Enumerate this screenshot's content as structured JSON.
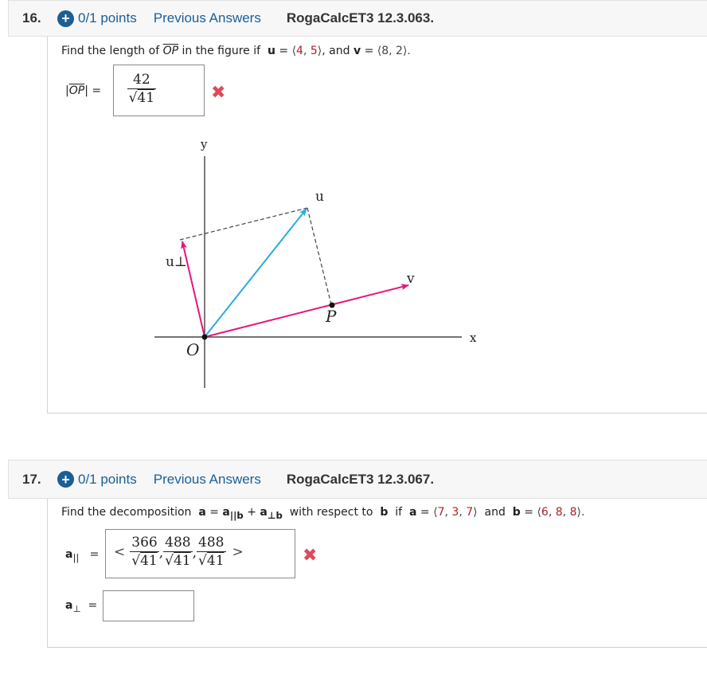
{
  "questions": [
    {
      "number": "16.",
      "points": "0/1 points",
      "previous_answers": "Previous Answers",
      "source": "RogaCalcET3 12.3.063.",
      "prompt": {
        "part1": "Find the length of",
        "op": "OP",
        "part2": "in the figure if",
        "u": "u",
        "eq": "=",
        "u_open": "⟨",
        "u_x": "4",
        "comma": ",",
        "u_y": "5",
        "u_close": "⟩",
        "and": ", and",
        "v": "v",
        "v_open": "⟨",
        "v_x": "8",
        "v_y": "2",
        "v_close": "⟩."
      },
      "answer_label": "|OP| =",
      "answer_label_op": "OP",
      "answer": {
        "numerator": "42",
        "denominator": "41",
        "radical": "√"
      },
      "status": "incorrect",
      "figure": {
        "axis_x_label": "x",
        "axis_y_label": "y",
        "origin_label": "O",
        "point_label": "P",
        "u_label": "u",
        "v_label": "v",
        "u_perp_label": "u⊥",
        "colors": {
          "u": "#29abe2",
          "v": "#e6157f",
          "u_perp": "#e6157f",
          "dashed": "#444444"
        }
      }
    },
    {
      "number": "17.",
      "points": "0/1 points",
      "previous_answers": "Previous Answers",
      "source": "RogaCalcET3 12.3.067.",
      "prompt": {
        "part1": "Find the decomposition",
        "a": "a",
        "eq": "=",
        "a_par": "a",
        "sub_par": "||b",
        "plus": "+",
        "a_perp": "a",
        "sub_perp": "⊥b",
        "part2": "with respect to",
        "b": "b",
        "if": "if",
        "a2": "a",
        "a_vals": [
          "7",
          "3",
          "7"
        ],
        "and": "and",
        "b2": "b",
        "b_vals": [
          "6",
          "8",
          "8"
        ]
      },
      "a_parallel": {
        "label": "a",
        "sub": "||",
        "eq": "=",
        "open": "<",
        "close": ">",
        "radical": "√",
        "components": [
          {
            "numerator": "366",
            "denominator": "41"
          },
          {
            "numerator": "488",
            "denominator": "41"
          },
          {
            "numerator": "488",
            "denominator": "41"
          }
        ],
        "status": "incorrect"
      },
      "a_perp": {
        "label": "a",
        "sub": "⊥",
        "eq": "=",
        "value": ""
      }
    }
  ],
  "icons": {
    "plus": "+",
    "incorrect": "✖"
  },
  "colors": {
    "link": "#1a5f96",
    "value_red": "#b0202a",
    "incorrect": "#e0495a"
  }
}
